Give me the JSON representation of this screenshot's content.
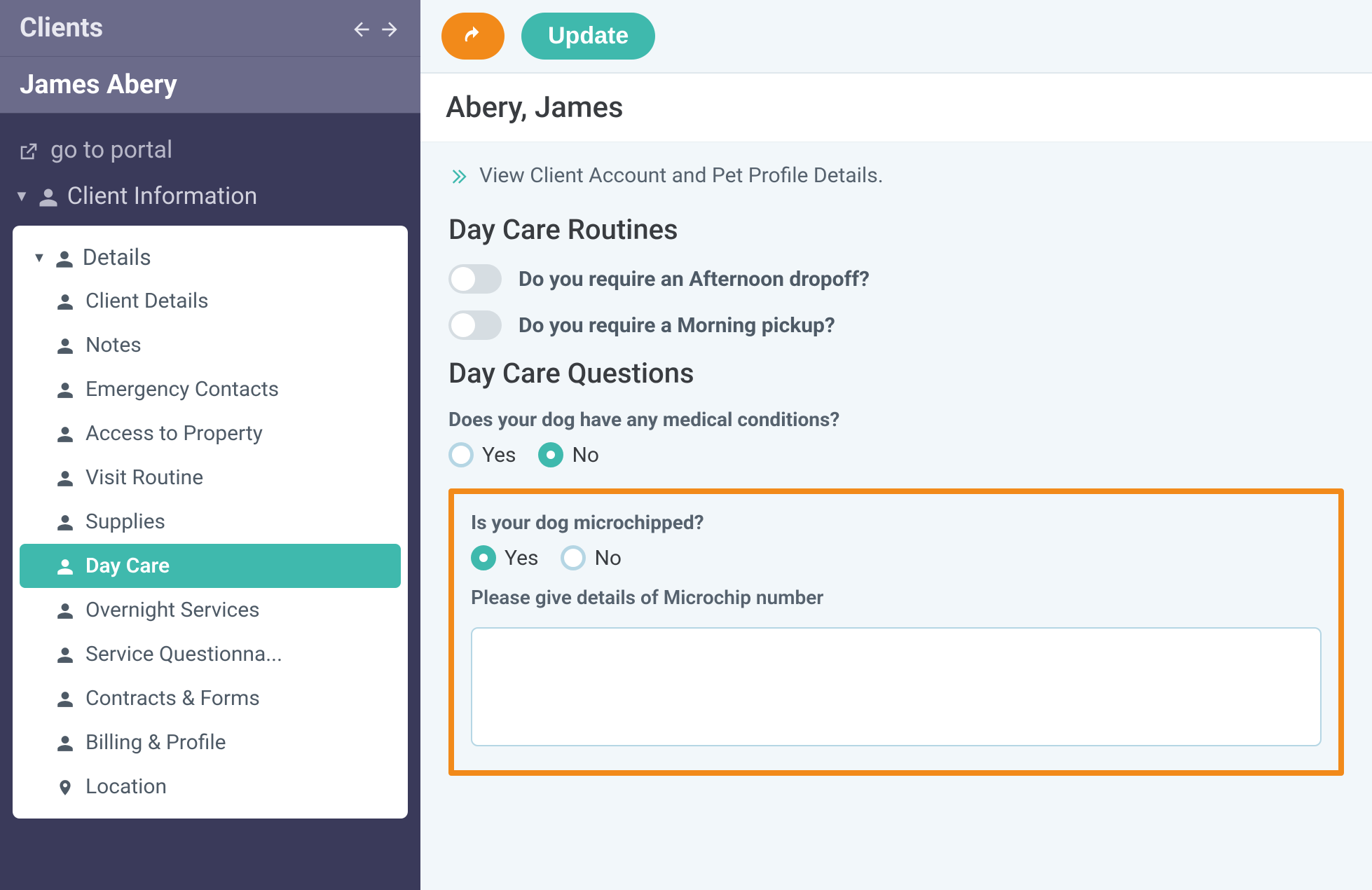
{
  "sidebar": {
    "header_title": "Clients",
    "client_name": "James Abery",
    "portal_link": "go to portal",
    "section_label": "Client Information",
    "details_label": "Details",
    "items": [
      {
        "label": "Client Details",
        "icon": "person"
      },
      {
        "label": "Notes",
        "icon": "person"
      },
      {
        "label": "Emergency Contacts",
        "icon": "person"
      },
      {
        "label": "Access to Property",
        "icon": "person"
      },
      {
        "label": "Visit Routine",
        "icon": "person"
      },
      {
        "label": "Supplies",
        "icon": "person"
      },
      {
        "label": "Day Care",
        "icon": "person"
      },
      {
        "label": "Overnight Services",
        "icon": "person"
      },
      {
        "label": "Service Questionna...",
        "icon": "person"
      },
      {
        "label": "Contracts & Forms",
        "icon": "person"
      },
      {
        "label": "Billing & Profile",
        "icon": "person"
      },
      {
        "label": "Location",
        "icon": "location"
      }
    ],
    "active_index": 6
  },
  "toolbar": {
    "update_label": "Update"
  },
  "content": {
    "client_display_name": "Abery, James",
    "view_link_text": "View Client Account and Pet Profile Details.",
    "routines_title": "Day Care Routines",
    "toggles": [
      {
        "label": "Do you require an Afternoon dropoff?",
        "value": false
      },
      {
        "label": "Do you require a Morning pickup?",
        "value": false
      }
    ],
    "questions_title": "Day Care Questions",
    "q_medical": {
      "label": "Does your dog have any medical conditions?",
      "options": {
        "yes": "Yes",
        "no": "No"
      },
      "selected": "no"
    },
    "q_microchip": {
      "label": "Is your dog microchipped?",
      "options": {
        "yes": "Yes",
        "no": "No"
      },
      "selected": "yes"
    },
    "microchip_details": {
      "label": "Please give details of Microchip number",
      "value": ""
    }
  },
  "colors": {
    "accent": "#3fb9ad",
    "orange": "#f28a1a",
    "sidebar_bg": "#3a3a5a",
    "sidebar_header_bg": "#6b6b8a"
  }
}
